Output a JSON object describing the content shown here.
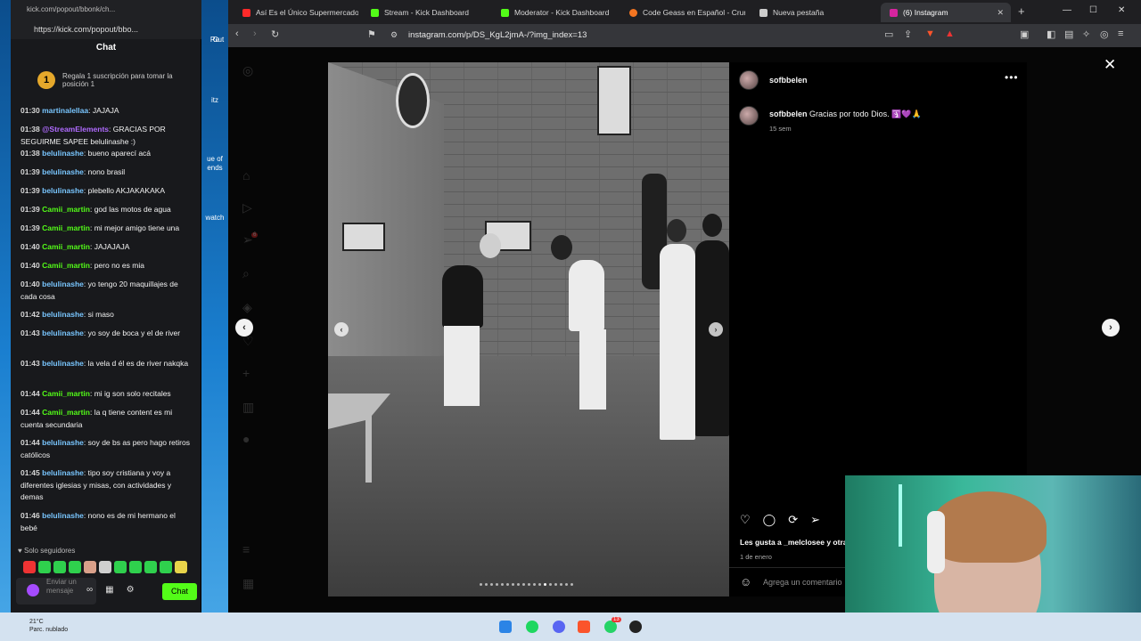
{
  "desktop": {
    "icons": [
      "Re",
      "Cut",
      "itz",
      "ue of",
      "ends",
      "watch"
    ]
  },
  "browser": {
    "tabs": [
      {
        "label": "Así Es el Único Supermercado P",
        "color": "#ff2a2a"
      },
      {
        "label": "Stream - Kick Dashboard",
        "color": "#53fc18"
      },
      {
        "label": "Moderator - Kick Dashboard",
        "color": "#53fc18"
      },
      {
        "label": "Code Geass en Español - Crunc",
        "color": "#f47521"
      },
      {
        "label": "Nueva pestaña",
        "color": "#cccccc"
      },
      {
        "label": "(6) Instagram",
        "color": "#d6249f"
      }
    ],
    "url": "instagram.com/p/DS_KgL2jmA-/?img_index=13"
  },
  "post": {
    "username": "sofbbelen",
    "caption_user": "sofbbelen",
    "caption_text": "Gracias por todo Dios. 🛐💜🙏",
    "caption_age": "15 sem",
    "likes_text": "Les gusta a _melclosee y otra",
    "date": "1 de enero",
    "comment_placeholder": "Agrega un comentario",
    "carousel_total": 18,
    "carousel_active": 13,
    "notification_count": "6"
  },
  "chat": {
    "popout_title": "kick.com/popout/bbonk/ch...",
    "popout_url": "https://kick.com/popout/bbo...",
    "title": "Chat",
    "promo_rank": "1",
    "promo_text": "Regala 1 suscripción para tomar la posición 1",
    "messages": [
      {
        "time": "01:30",
        "user": "martinalellaa",
        "color": "#79c6ff",
        "text": ": JAJAJA"
      },
      {
        "time": "01:38",
        "user": "@StreamElements",
        "color": "#b06bff",
        "text": ": GRACIAS POR SEGUIRME SAPEE belulinashe :)"
      },
      {
        "time": "01:38",
        "user": "belulinashe",
        "color": "#79c6ff",
        "text": ": bueno aparecí acá"
      },
      {
        "time": "01:39",
        "user": "belulinashe",
        "color": "#79c6ff",
        "text": ": nono brasil"
      },
      {
        "time": "01:39",
        "user": "belulinashe",
        "color": "#79c6ff",
        "text": ": plebello AKJAKAKAKA"
      },
      {
        "time": "01:39",
        "user": "Camii_martin",
        "color": "#53fc18",
        "text": ": god las motos de agua"
      },
      {
        "time": "01:39",
        "user": "Camii_martin",
        "color": "#53fc18",
        "text": ": mi mejor amigo tiene una"
      },
      {
        "time": "01:40",
        "user": "Camii_martin",
        "color": "#53fc18",
        "text": ": JAJAJAJA"
      },
      {
        "time": "01:40",
        "user": "Camii_martin",
        "color": "#53fc18",
        "text": ": pero no es mia"
      },
      {
        "time": "01:40",
        "user": "belulinashe",
        "color": "#79c6ff",
        "text": ": yo tengo 20 maquillajes de cada cosa"
      },
      {
        "time": "01:42",
        "user": "belulinashe",
        "color": "#79c6ff",
        "text": ": si maso"
      },
      {
        "time": "01:43",
        "user": "belulinashe",
        "color": "#79c6ff",
        "text": ": yo soy de boca y el de river"
      },
      {
        "time": "01:43",
        "user": "belulinashe",
        "color": "#79c6ff",
        "text": ": la vela d él es de river nakqka"
      },
      {
        "time": "01:44",
        "user": "Camii_martin",
        "color": "#53fc18",
        "text": ": mi ig son solo recitales"
      },
      {
        "time": "01:44",
        "user": "Camii_martin",
        "color": "#53fc18",
        "text": ": la q tiene content es mi cuenta secundaria"
      },
      {
        "time": "01:44",
        "user": "belulinashe",
        "color": "#79c6ff",
        "text": ": soy de bs as pero hago retiros católicos"
      },
      {
        "time": "01:45",
        "user": "belulinashe",
        "color": "#79c6ff",
        "text": ": tipo soy cristiana y voy a diferentes iglesias y misas, con actividades y demas"
      },
      {
        "time": "01:46",
        "user": "belulinashe",
        "color": "#79c6ff",
        "text": ": nono es de mi hermano el bebé"
      }
    ],
    "followers_only": "Solo seguidores",
    "input_placeholder": "Enviar un mensaje",
    "send_label": "Chat"
  },
  "taskbar": {
    "temperature": "21°C",
    "condition": "Parc. nublado",
    "badge_count": "13"
  }
}
